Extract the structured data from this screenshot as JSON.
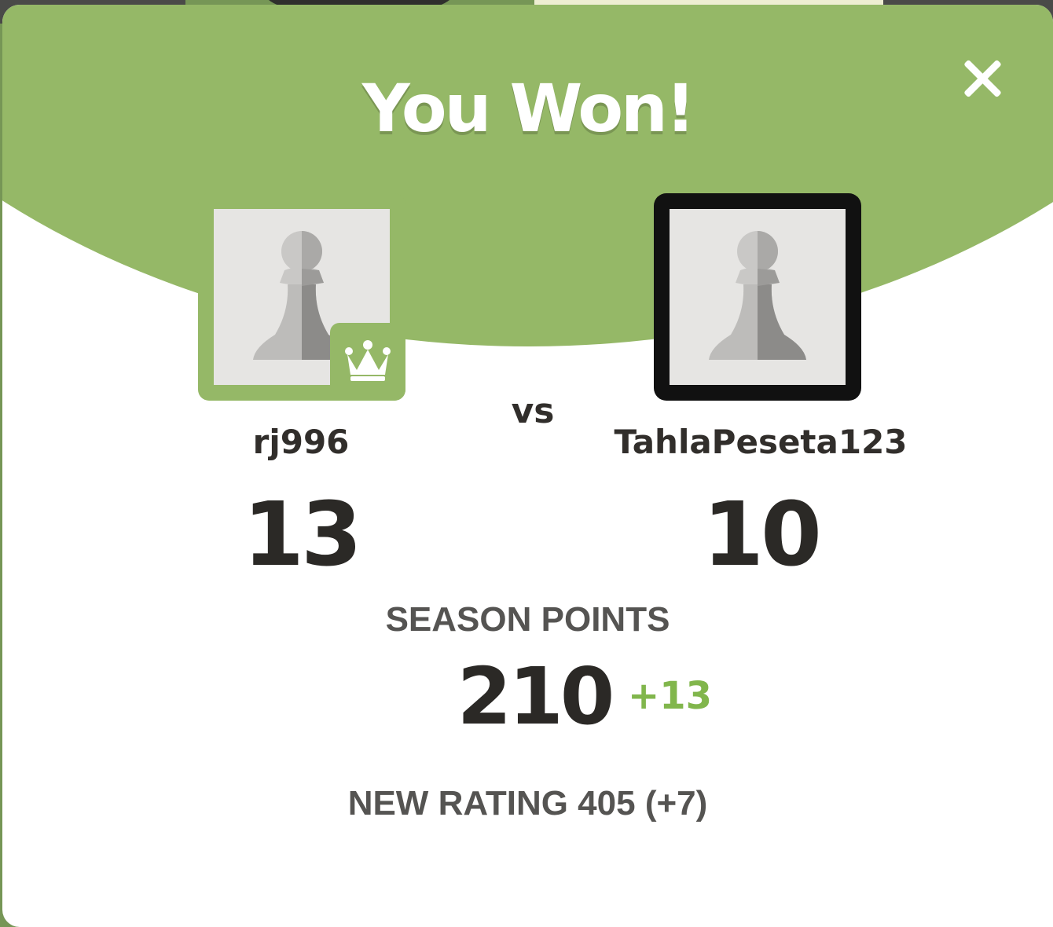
{
  "modal": {
    "title": "You Won!",
    "close_icon": "close-icon"
  },
  "players": {
    "left": {
      "name": "rj996",
      "score": "13",
      "avatar_icon": "pawn-avatar-icon",
      "badge_icon": "crown-icon"
    },
    "right": {
      "name": "TahlaPeseta123",
      "score": "10",
      "avatar_icon": "pawn-avatar-icon"
    },
    "vs_label": "vs"
  },
  "season": {
    "label": "SEASON POINTS",
    "value": "210",
    "delta": "+13"
  },
  "rating": {
    "text": "NEW RATING 405 (+7)"
  },
  "colors": {
    "header_green": "#95b867",
    "delta_green": "#81b64c",
    "text_dark": "#2b2926",
    "text_gray": "#555452",
    "winner_frame": "#95b867",
    "opponent_frame": "#111111"
  }
}
